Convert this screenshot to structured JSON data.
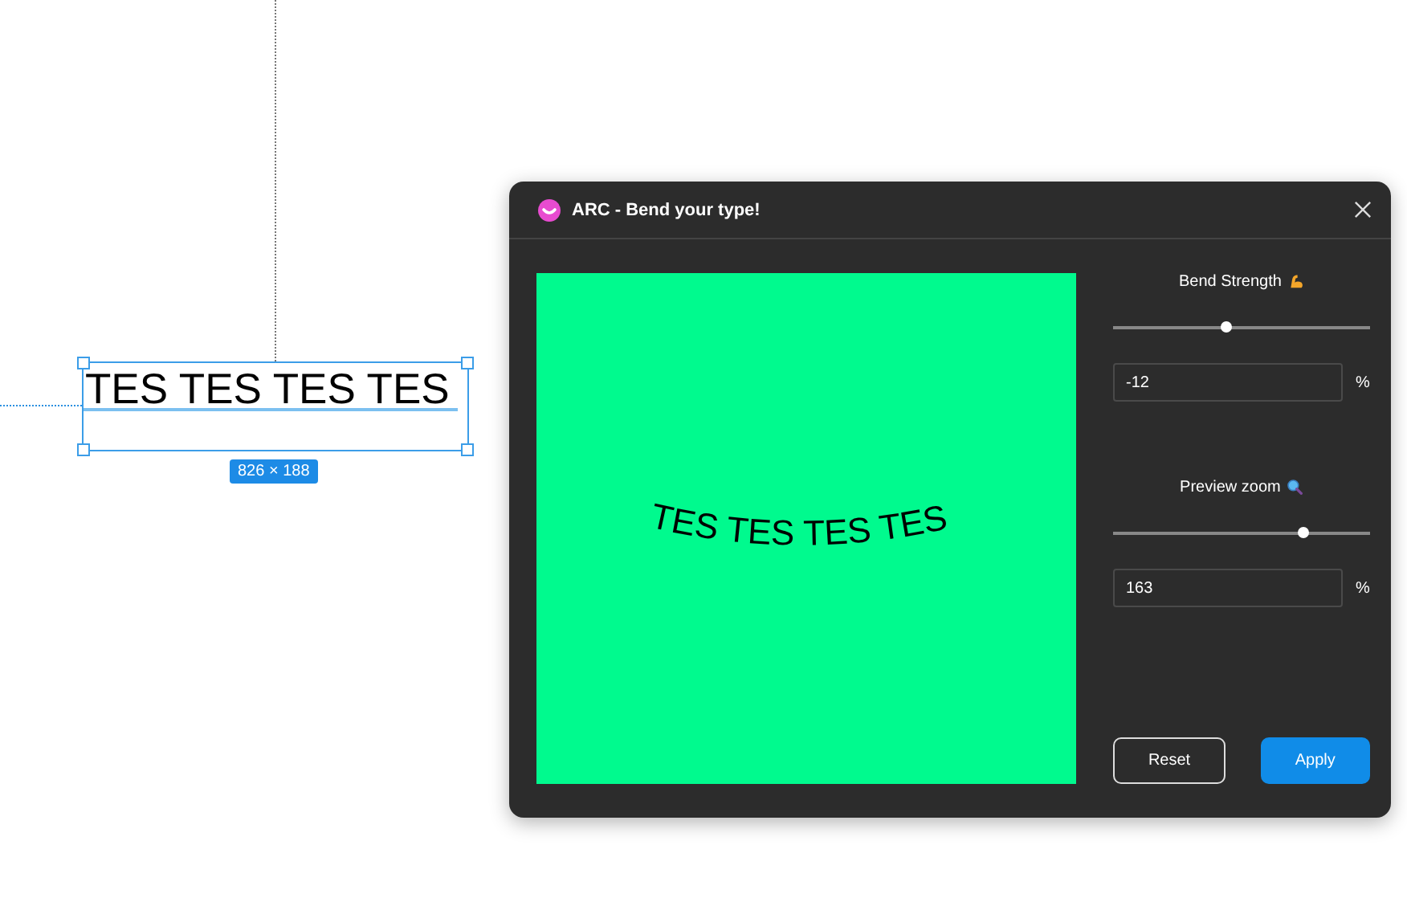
{
  "canvas": {
    "text_layer": {
      "text": "TES TES TES TES",
      "dimensions": "826 × 188"
    }
  },
  "dialog": {
    "title": "ARC - Bend your type!",
    "preview": {
      "text": "TES TES TES TES"
    },
    "controls": [
      {
        "label": "Bend Strength",
        "kind": "arm",
        "level": 0.44,
        "value": "-12",
        "unit": "%"
      },
      {
        "label": "Preview zoom",
        "kind": "magnifier",
        "level": 0.74,
        "value": "163",
        "unit": "%"
      }
    ],
    "buttons": [
      {
        "label": "Reset",
        "kind": "secondary"
      },
      {
        "label": "Apply",
        "kind": "primary"
      }
    ]
  }
}
